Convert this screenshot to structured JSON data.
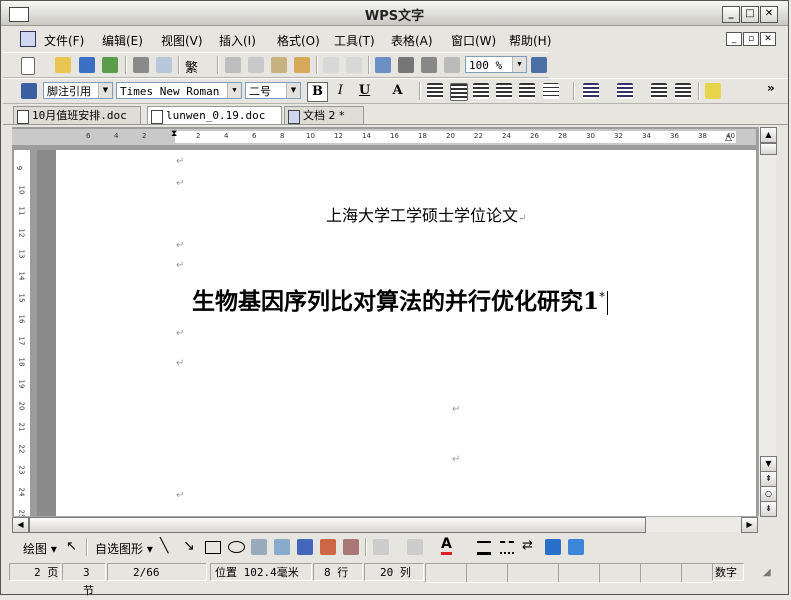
{
  "window": {
    "title": "WPS文字"
  },
  "menu": [
    "文件(F)",
    "编辑(E)",
    "视图(V)",
    "插入(I)",
    "格式(O)",
    "工具(T)",
    "表格(A)",
    "窗口(W)",
    "帮助(H)"
  ],
  "toolbar": {
    "zoom": "100 %",
    "traditional": "繁"
  },
  "format": {
    "style": "脚注引用",
    "font": "Times New Roman",
    "size": "二号",
    "bold": "B",
    "italic": "I",
    "underline": "U",
    "charscale": "A"
  },
  "tabs": [
    {
      "label": "10月值班安排.doc",
      "active": false
    },
    {
      "label": "lunwen_0.19.doc",
      "active": true
    },
    {
      "label": "文档 2 *",
      "active": false
    }
  ],
  "ruler": {
    "h_ticks": [
      "6",
      "4",
      "2",
      "2",
      "4",
      "6",
      "8",
      "10",
      "12",
      "14",
      "16",
      "18",
      "20",
      "22",
      "24",
      "26",
      "28",
      "30",
      "32",
      "34",
      "36",
      "38",
      "40"
    ],
    "v_ticks": [
      "9",
      "10",
      "11",
      "12",
      "13",
      "14",
      "15",
      "16",
      "17",
      "18",
      "19",
      "20",
      "21",
      "22",
      "23",
      "24",
      "25"
    ]
  },
  "document": {
    "subtitle": "上海大学工学硕士学位论文",
    "title": "生物基因序列比对算法的并行优化研究",
    "footnote_mark": "1",
    "footnote_star": "*",
    "para_mark": "↵"
  },
  "draw": {
    "draw_label": "绘图",
    "autoshape_label": "自选图形"
  },
  "status": {
    "page": "2 页",
    "section": "3 节",
    "pages": "2/66",
    "position": "位置 102.4毫米",
    "line": "8 行",
    "column": "20 列",
    "numlock": "数字"
  }
}
